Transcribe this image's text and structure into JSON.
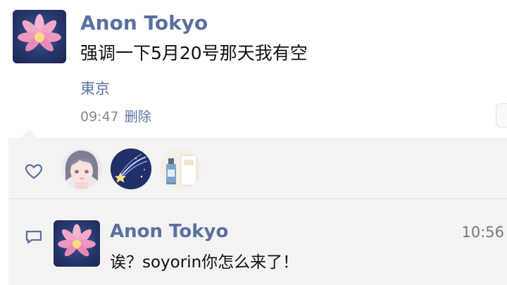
{
  "post": {
    "author": "Anon Tokyo",
    "text": "强调一下5月20号那天我有空",
    "location": "東京",
    "time": "09:47",
    "delete_label": "删除",
    "avatar_icon": "lotus-avatar"
  },
  "likes": {
    "icon": "heart-outline-icon",
    "likers": [
      {
        "avatar_icon": "anime-girl-avatar"
      },
      {
        "avatar_icon": "shooting-star-avatar"
      },
      {
        "avatar_icon": "perfume-bottle-avatar"
      }
    ]
  },
  "comments": [
    {
      "icon": "comment-bubble-icon",
      "author": "Anon Tokyo",
      "time": "10:56",
      "text": "诶？soyorin你怎么来了！",
      "avatar_icon": "lotus-avatar"
    }
  ],
  "colors": {
    "name": "#5c6fa0",
    "panel": "#f3f3f3",
    "avatar_bg": "#27386e",
    "lotus": "#f3a6c8"
  }
}
